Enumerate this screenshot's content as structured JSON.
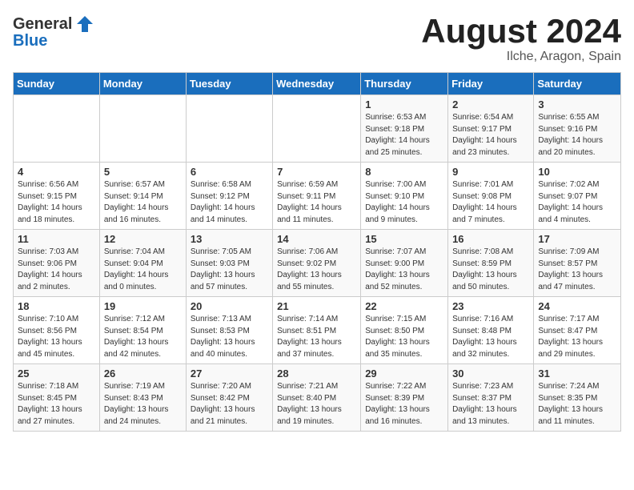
{
  "logo": {
    "general": "General",
    "blue": "Blue"
  },
  "title": "August 2024",
  "subtitle": "Ilche, Aragon, Spain",
  "days_of_week": [
    "Sunday",
    "Monday",
    "Tuesday",
    "Wednesday",
    "Thursday",
    "Friday",
    "Saturday"
  ],
  "weeks": [
    [
      {
        "day": "",
        "info": ""
      },
      {
        "day": "",
        "info": ""
      },
      {
        "day": "",
        "info": ""
      },
      {
        "day": "",
        "info": ""
      },
      {
        "day": "1",
        "info": "Sunrise: 6:53 AM\nSunset: 9:18 PM\nDaylight: 14 hours and 25 minutes."
      },
      {
        "day": "2",
        "info": "Sunrise: 6:54 AM\nSunset: 9:17 PM\nDaylight: 14 hours and 23 minutes."
      },
      {
        "day": "3",
        "info": "Sunrise: 6:55 AM\nSunset: 9:16 PM\nDaylight: 14 hours and 20 minutes."
      }
    ],
    [
      {
        "day": "4",
        "info": "Sunrise: 6:56 AM\nSunset: 9:15 PM\nDaylight: 14 hours and 18 minutes."
      },
      {
        "day": "5",
        "info": "Sunrise: 6:57 AM\nSunset: 9:14 PM\nDaylight: 14 hours and 16 minutes."
      },
      {
        "day": "6",
        "info": "Sunrise: 6:58 AM\nSunset: 9:12 PM\nDaylight: 14 hours and 14 minutes."
      },
      {
        "day": "7",
        "info": "Sunrise: 6:59 AM\nSunset: 9:11 PM\nDaylight: 14 hours and 11 minutes."
      },
      {
        "day": "8",
        "info": "Sunrise: 7:00 AM\nSunset: 9:10 PM\nDaylight: 14 hours and 9 minutes."
      },
      {
        "day": "9",
        "info": "Sunrise: 7:01 AM\nSunset: 9:08 PM\nDaylight: 14 hours and 7 minutes."
      },
      {
        "day": "10",
        "info": "Sunrise: 7:02 AM\nSunset: 9:07 PM\nDaylight: 14 hours and 4 minutes."
      }
    ],
    [
      {
        "day": "11",
        "info": "Sunrise: 7:03 AM\nSunset: 9:06 PM\nDaylight: 14 hours and 2 minutes."
      },
      {
        "day": "12",
        "info": "Sunrise: 7:04 AM\nSunset: 9:04 PM\nDaylight: 14 hours and 0 minutes."
      },
      {
        "day": "13",
        "info": "Sunrise: 7:05 AM\nSunset: 9:03 PM\nDaylight: 13 hours and 57 minutes."
      },
      {
        "day": "14",
        "info": "Sunrise: 7:06 AM\nSunset: 9:02 PM\nDaylight: 13 hours and 55 minutes."
      },
      {
        "day": "15",
        "info": "Sunrise: 7:07 AM\nSunset: 9:00 PM\nDaylight: 13 hours and 52 minutes."
      },
      {
        "day": "16",
        "info": "Sunrise: 7:08 AM\nSunset: 8:59 PM\nDaylight: 13 hours and 50 minutes."
      },
      {
        "day": "17",
        "info": "Sunrise: 7:09 AM\nSunset: 8:57 PM\nDaylight: 13 hours and 47 minutes."
      }
    ],
    [
      {
        "day": "18",
        "info": "Sunrise: 7:10 AM\nSunset: 8:56 PM\nDaylight: 13 hours and 45 minutes."
      },
      {
        "day": "19",
        "info": "Sunrise: 7:12 AM\nSunset: 8:54 PM\nDaylight: 13 hours and 42 minutes."
      },
      {
        "day": "20",
        "info": "Sunrise: 7:13 AM\nSunset: 8:53 PM\nDaylight: 13 hours and 40 minutes."
      },
      {
        "day": "21",
        "info": "Sunrise: 7:14 AM\nSunset: 8:51 PM\nDaylight: 13 hours and 37 minutes."
      },
      {
        "day": "22",
        "info": "Sunrise: 7:15 AM\nSunset: 8:50 PM\nDaylight: 13 hours and 35 minutes."
      },
      {
        "day": "23",
        "info": "Sunrise: 7:16 AM\nSunset: 8:48 PM\nDaylight: 13 hours and 32 minutes."
      },
      {
        "day": "24",
        "info": "Sunrise: 7:17 AM\nSunset: 8:47 PM\nDaylight: 13 hours and 29 minutes."
      }
    ],
    [
      {
        "day": "25",
        "info": "Sunrise: 7:18 AM\nSunset: 8:45 PM\nDaylight: 13 hours and 27 minutes."
      },
      {
        "day": "26",
        "info": "Sunrise: 7:19 AM\nSunset: 8:43 PM\nDaylight: 13 hours and 24 minutes."
      },
      {
        "day": "27",
        "info": "Sunrise: 7:20 AM\nSunset: 8:42 PM\nDaylight: 13 hours and 21 minutes."
      },
      {
        "day": "28",
        "info": "Sunrise: 7:21 AM\nSunset: 8:40 PM\nDaylight: 13 hours and 19 minutes."
      },
      {
        "day": "29",
        "info": "Sunrise: 7:22 AM\nSunset: 8:39 PM\nDaylight: 13 hours and 16 minutes."
      },
      {
        "day": "30",
        "info": "Sunrise: 7:23 AM\nSunset: 8:37 PM\nDaylight: 13 hours and 13 minutes."
      },
      {
        "day": "31",
        "info": "Sunrise: 7:24 AM\nSunset: 8:35 PM\nDaylight: 13 hours and 11 minutes."
      }
    ]
  ]
}
